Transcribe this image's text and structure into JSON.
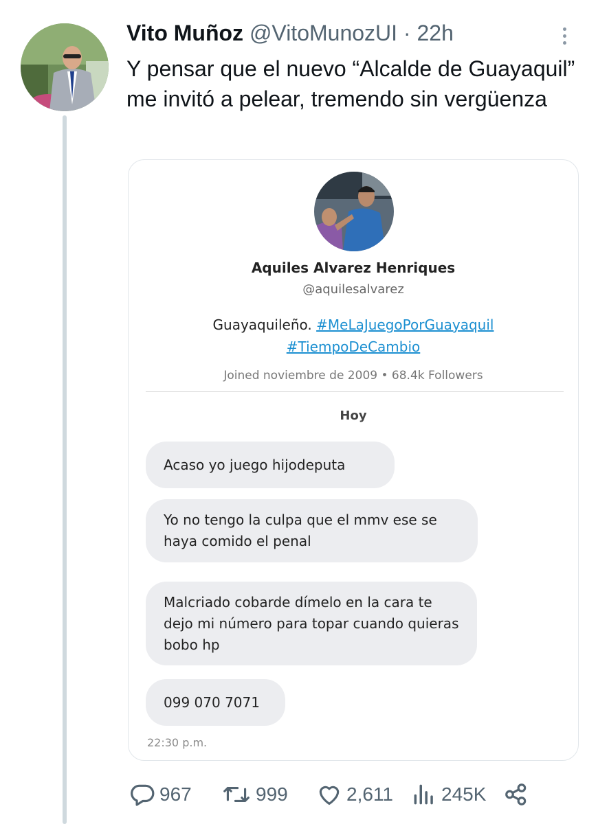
{
  "tweet": {
    "author_name": "Vito Muñoz",
    "author_handle": "@VitoMunozUI",
    "separator": "·",
    "time": "22h",
    "text": "Y pensar que el nuevo “Alcalde de Guayaquil” me invitó a pelear, tremendo sin vergüenza"
  },
  "embedded_screenshot": {
    "profile_name": "Aquiles Alvarez Henriques",
    "profile_handle": "@aquilesalvarez",
    "bio_text": "Guayaquileño.",
    "hashtags": [
      "#MeLaJuegoPorGuayaquil",
      "#TiempoDeCambio"
    ],
    "meta": "Joined noviembre de 2009 • 68.4k Followers",
    "day_label": "Hoy",
    "messages": [
      "Acaso yo juego hijodeputa",
      "Yo no tengo la culpa que el mmv ese se haya comido el penal",
      "Malcriado cobarde dímelo en la cara te dejo mi número para topar cuando quieras bobo hp",
      "099 070 7071"
    ],
    "timestamp": "22:30 p.m."
  },
  "actions": {
    "replies": "967",
    "retweets": "999",
    "likes": "2,611",
    "views": "245K"
  },
  "icons": [
    "reply-icon",
    "retweet-icon",
    "like-icon",
    "views-icon",
    "share-icon",
    "more-icon"
  ],
  "colors": {
    "hashtag": "#1b8fd1",
    "icon_gray": "#536471",
    "bubble": "#ecedf0"
  }
}
